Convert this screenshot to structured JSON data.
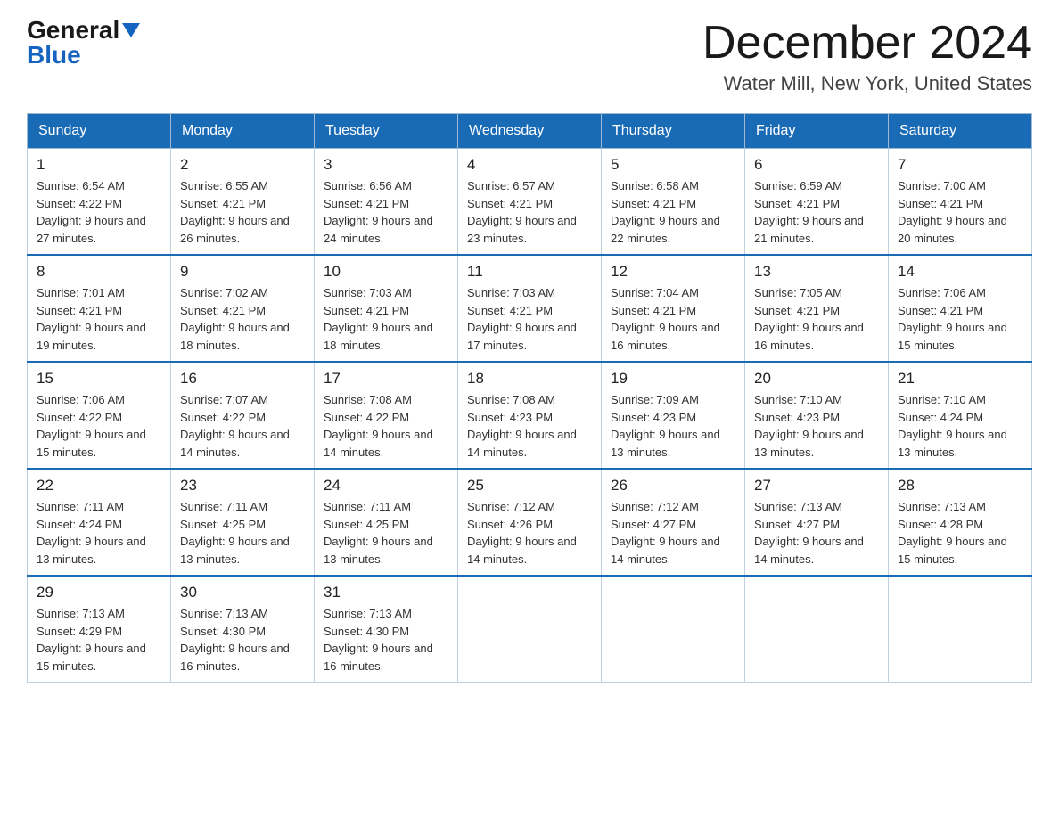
{
  "header": {
    "logo_general": "General",
    "logo_blue": "Blue",
    "month_year": "December 2024",
    "location": "Water Mill, New York, United States"
  },
  "days_of_week": [
    "Sunday",
    "Monday",
    "Tuesday",
    "Wednesday",
    "Thursday",
    "Friday",
    "Saturday"
  ],
  "weeks": [
    [
      {
        "day": "1",
        "sunrise": "6:54 AM",
        "sunset": "4:22 PM",
        "daylight": "9 hours and 27 minutes."
      },
      {
        "day": "2",
        "sunrise": "6:55 AM",
        "sunset": "4:21 PM",
        "daylight": "9 hours and 26 minutes."
      },
      {
        "day": "3",
        "sunrise": "6:56 AM",
        "sunset": "4:21 PM",
        "daylight": "9 hours and 24 minutes."
      },
      {
        "day": "4",
        "sunrise": "6:57 AM",
        "sunset": "4:21 PM",
        "daylight": "9 hours and 23 minutes."
      },
      {
        "day": "5",
        "sunrise": "6:58 AM",
        "sunset": "4:21 PM",
        "daylight": "9 hours and 22 minutes."
      },
      {
        "day": "6",
        "sunrise": "6:59 AM",
        "sunset": "4:21 PM",
        "daylight": "9 hours and 21 minutes."
      },
      {
        "day": "7",
        "sunrise": "7:00 AM",
        "sunset": "4:21 PM",
        "daylight": "9 hours and 20 minutes."
      }
    ],
    [
      {
        "day": "8",
        "sunrise": "7:01 AM",
        "sunset": "4:21 PM",
        "daylight": "9 hours and 19 minutes."
      },
      {
        "day": "9",
        "sunrise": "7:02 AM",
        "sunset": "4:21 PM",
        "daylight": "9 hours and 18 minutes."
      },
      {
        "day": "10",
        "sunrise": "7:03 AM",
        "sunset": "4:21 PM",
        "daylight": "9 hours and 18 minutes."
      },
      {
        "day": "11",
        "sunrise": "7:03 AM",
        "sunset": "4:21 PM",
        "daylight": "9 hours and 17 minutes."
      },
      {
        "day": "12",
        "sunrise": "7:04 AM",
        "sunset": "4:21 PM",
        "daylight": "9 hours and 16 minutes."
      },
      {
        "day": "13",
        "sunrise": "7:05 AM",
        "sunset": "4:21 PM",
        "daylight": "9 hours and 16 minutes."
      },
      {
        "day": "14",
        "sunrise": "7:06 AM",
        "sunset": "4:21 PM",
        "daylight": "9 hours and 15 minutes."
      }
    ],
    [
      {
        "day": "15",
        "sunrise": "7:06 AM",
        "sunset": "4:22 PM",
        "daylight": "9 hours and 15 minutes."
      },
      {
        "day": "16",
        "sunrise": "7:07 AM",
        "sunset": "4:22 PM",
        "daylight": "9 hours and 14 minutes."
      },
      {
        "day": "17",
        "sunrise": "7:08 AM",
        "sunset": "4:22 PM",
        "daylight": "9 hours and 14 minutes."
      },
      {
        "day": "18",
        "sunrise": "7:08 AM",
        "sunset": "4:23 PM",
        "daylight": "9 hours and 14 minutes."
      },
      {
        "day": "19",
        "sunrise": "7:09 AM",
        "sunset": "4:23 PM",
        "daylight": "9 hours and 13 minutes."
      },
      {
        "day": "20",
        "sunrise": "7:10 AM",
        "sunset": "4:23 PM",
        "daylight": "9 hours and 13 minutes."
      },
      {
        "day": "21",
        "sunrise": "7:10 AM",
        "sunset": "4:24 PM",
        "daylight": "9 hours and 13 minutes."
      }
    ],
    [
      {
        "day": "22",
        "sunrise": "7:11 AM",
        "sunset": "4:24 PM",
        "daylight": "9 hours and 13 minutes."
      },
      {
        "day": "23",
        "sunrise": "7:11 AM",
        "sunset": "4:25 PM",
        "daylight": "9 hours and 13 minutes."
      },
      {
        "day": "24",
        "sunrise": "7:11 AM",
        "sunset": "4:25 PM",
        "daylight": "9 hours and 13 minutes."
      },
      {
        "day": "25",
        "sunrise": "7:12 AM",
        "sunset": "4:26 PM",
        "daylight": "9 hours and 14 minutes."
      },
      {
        "day": "26",
        "sunrise": "7:12 AM",
        "sunset": "4:27 PM",
        "daylight": "9 hours and 14 minutes."
      },
      {
        "day": "27",
        "sunrise": "7:13 AM",
        "sunset": "4:27 PM",
        "daylight": "9 hours and 14 minutes."
      },
      {
        "day": "28",
        "sunrise": "7:13 AM",
        "sunset": "4:28 PM",
        "daylight": "9 hours and 15 minutes."
      }
    ],
    [
      {
        "day": "29",
        "sunrise": "7:13 AM",
        "sunset": "4:29 PM",
        "daylight": "9 hours and 15 minutes."
      },
      {
        "day": "30",
        "sunrise": "7:13 AM",
        "sunset": "4:30 PM",
        "daylight": "9 hours and 16 minutes."
      },
      {
        "day": "31",
        "sunrise": "7:13 AM",
        "sunset": "4:30 PM",
        "daylight": "9 hours and 16 minutes."
      },
      null,
      null,
      null,
      null
    ]
  ]
}
